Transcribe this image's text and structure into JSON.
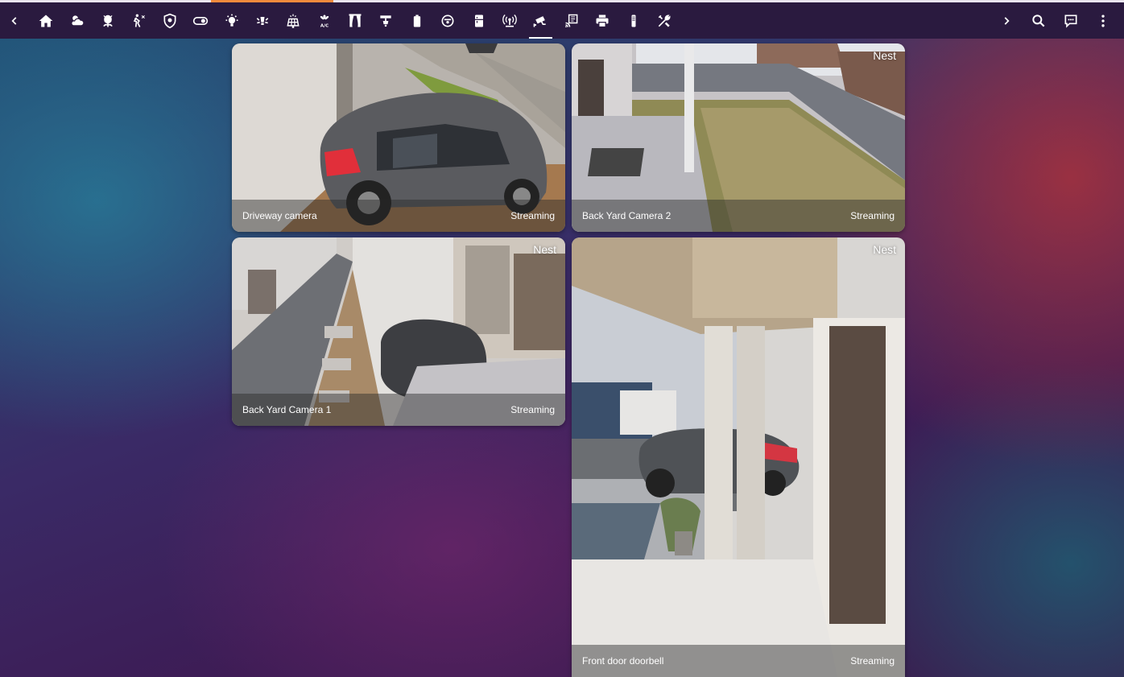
{
  "toolbar": {
    "tabs": [
      {
        "icon": "home-icon"
      },
      {
        "icon": "weather-partly-cloudy-icon"
      },
      {
        "icon": "flower-icon"
      },
      {
        "icon": "motion-sensor-icon"
      },
      {
        "icon": "shield-icon"
      },
      {
        "icon": "toggle-switch-icon"
      },
      {
        "icon": "lightbulb-icon"
      },
      {
        "icon": "spotlight-icon"
      },
      {
        "icon": "solar-panel-icon"
      },
      {
        "icon": "air-conditioner-icon"
      },
      {
        "icon": "curtains-icon"
      },
      {
        "icon": "ceiling-light-icon"
      },
      {
        "icon": "battery-icon"
      },
      {
        "icon": "robot-vacuum-icon"
      },
      {
        "icon": "fridge-icon"
      },
      {
        "icon": "access-point-icon"
      },
      {
        "icon": "cctv-icon",
        "active": true
      },
      {
        "icon": "network-icon"
      },
      {
        "icon": "printer-icon"
      },
      {
        "icon": "air-purifier-icon"
      },
      {
        "icon": "tools-icon"
      }
    ],
    "actions": [
      "scroll-right-icon",
      "search-icon",
      "assist-icon",
      "menu-dots-icon"
    ]
  },
  "cameras": [
    {
      "name": "Driveway camera",
      "status": "Streaming",
      "badge": ""
    },
    {
      "name": "Back Yard Camera 2",
      "status": "Streaming",
      "badge": "Nest"
    },
    {
      "name": "Back Yard Camera 1",
      "status": "Streaming",
      "badge": "Nest"
    },
    {
      "name": "Front door doorbell",
      "status": "Streaming",
      "badge": "Nest"
    }
  ],
  "colors": {
    "toolbar": "#2a1a3f",
    "accent": "#f08a3c",
    "text": "#ffffff"
  }
}
